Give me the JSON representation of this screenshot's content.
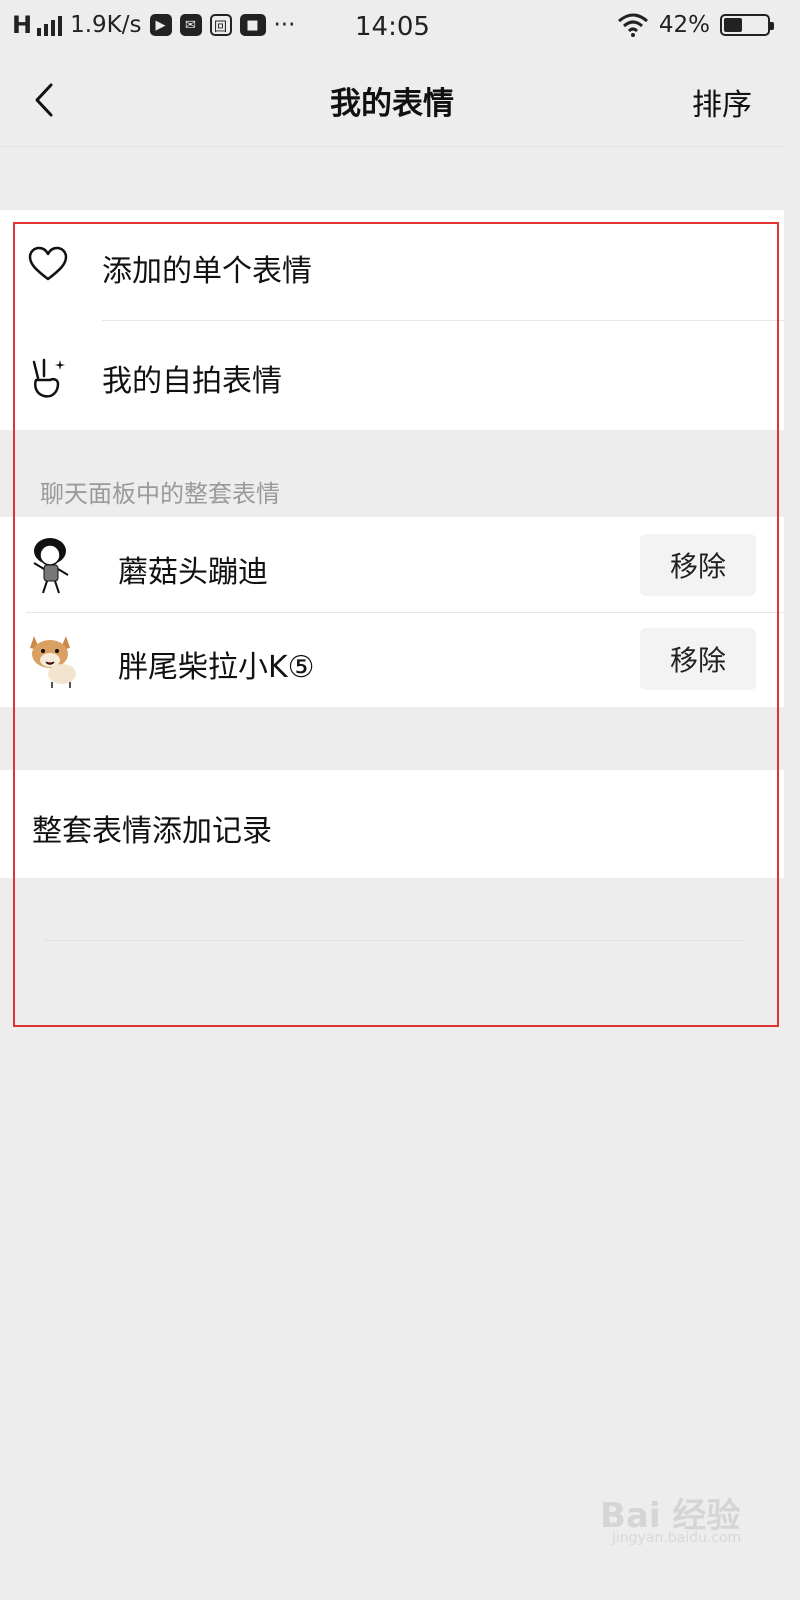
{
  "status_bar": {
    "network": "H",
    "speed": "1.9K/s",
    "more": "···",
    "time": "14:05",
    "battery_percent": "42%",
    "battery_level": 0.42,
    "icons": [
      "signal-icon",
      "play-icon",
      "mail-icon",
      "app-icon",
      "video-icon",
      "wifi-icon",
      "battery-icon"
    ]
  },
  "nav": {
    "title": "我的表情",
    "sort_label": "排序",
    "back_icon": "chevron-left-icon"
  },
  "single": {
    "items": [
      {
        "label": "添加的单个表情",
        "icon": "heart-icon"
      },
      {
        "label": "我的自拍表情",
        "icon": "victory-hand-icon"
      }
    ]
  },
  "packs": {
    "header": "聊天面板中的整套表情",
    "items": [
      {
        "name": "蘑菇头蹦迪",
        "action": "移除"
      },
      {
        "name": "胖尾柴拉小K⑤",
        "action": "移除"
      }
    ]
  },
  "history": {
    "label": "整套表情添加记录"
  },
  "watermark": {
    "text": "Bai 经验",
    "sub": "jingyan.baidu.com"
  },
  "colors": {
    "background": "#ededed",
    "card": "#ffffff",
    "highlight": "#e03333",
    "header_text": "#9a9a9a"
  }
}
